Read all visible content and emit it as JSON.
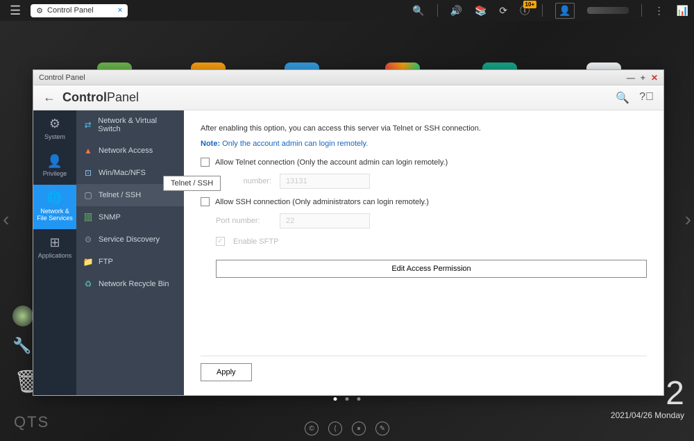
{
  "topbar": {
    "tab_title": "Control Panel",
    "notification_badge": "10+"
  },
  "window": {
    "title": "Control Panel",
    "header_bold": "Control",
    "header_light": "Panel"
  },
  "rail": [
    {
      "label": "System"
    },
    {
      "label": "Privilege"
    },
    {
      "label": "Network & File Services"
    },
    {
      "label": "Applications"
    }
  ],
  "sidebar": {
    "items": [
      {
        "label": "Network & Virtual Switch"
      },
      {
        "label": "Network Access"
      },
      {
        "label": "Win/Mac/NFS"
      },
      {
        "label": "Telnet / SSH"
      },
      {
        "label": "SNMP"
      },
      {
        "label": "Service Discovery"
      },
      {
        "label": "FTP"
      },
      {
        "label": "Network Recycle Bin"
      }
    ],
    "tooltip": "Telnet / SSH"
  },
  "content": {
    "intro": "After enabling this option, you can access this server via Telnet or SSH connection.",
    "note_label": "Note:",
    "note_text": "Only the account admin can login remotely.",
    "telnet_label": "Allow Telnet connection (Only the account admin can login remotely.)",
    "telnet_port_label": "number:",
    "telnet_port_value": "13131",
    "ssh_label": "Allow SSH connection (Only administrators can login remotely.)",
    "ssh_port_label": "Port number:",
    "ssh_port_value": "22",
    "sftp_label": "Enable SFTP",
    "edit_btn": "Edit Access Permission",
    "apply_btn": "Apply"
  },
  "desktop": {
    "qts": "QTS",
    "time": "2",
    "date": "2021/04/26 Monday"
  }
}
